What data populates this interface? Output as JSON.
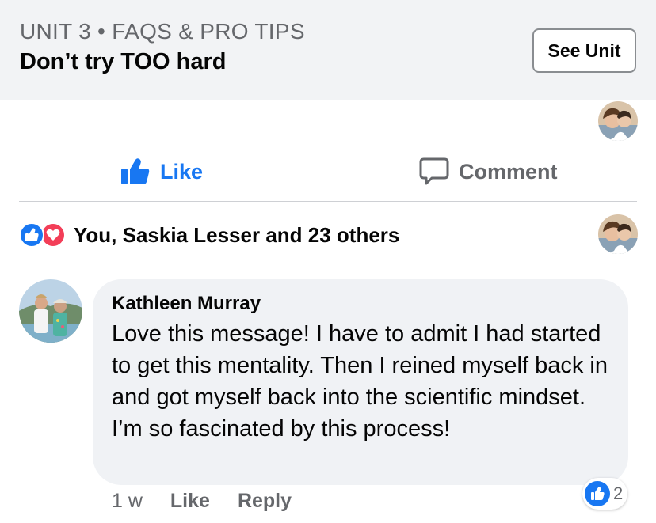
{
  "unit_header": {
    "kicker": "UNIT 3 • FAQS & PRO TIPS",
    "title": "Don’t try TOO hard",
    "see_unit_label": "See Unit"
  },
  "actions": {
    "like_label": "Like",
    "comment_label": "Comment"
  },
  "reactions": {
    "summary": "You, Saskia Lesser and 23 others",
    "types": [
      "like",
      "love"
    ]
  },
  "comment": {
    "author": "Kathleen Murray",
    "text": "Love this message! I have to admit I had started to get this mentality. Then I reined myself back in and got myself back into the scientific mindset. I’m so fascinated by this process!",
    "time": "1 w",
    "like_label": "Like",
    "reply_label": "Reply",
    "reaction_count": "2"
  },
  "colors": {
    "accent": "#1877f2",
    "love": "#f33e58",
    "secondary_text": "#65676b",
    "header_bg": "#f2f3f5",
    "bubble_bg": "#f0f2f5"
  }
}
